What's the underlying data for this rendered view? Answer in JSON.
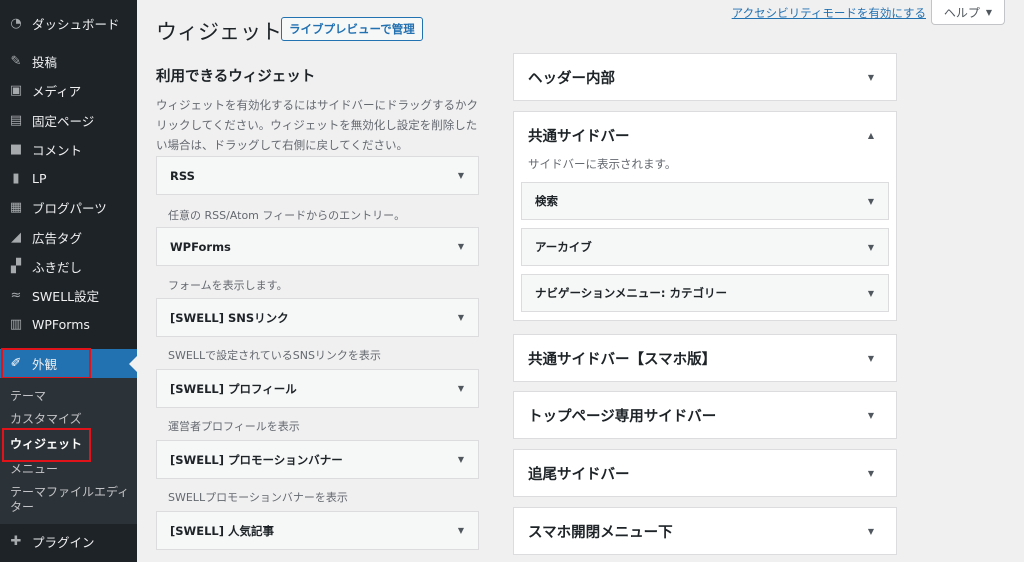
{
  "sidebar": {
    "items": [
      {
        "label": "ダッシュボード",
        "icon": "dashboard-icon",
        "glyph": "◔"
      },
      {
        "label": "投稿",
        "icon": "pin-icon",
        "glyph": "✎"
      },
      {
        "label": "メディア",
        "icon": "media-icon",
        "glyph": "▣"
      },
      {
        "label": "固定ページ",
        "icon": "page-icon",
        "glyph": "▤"
      },
      {
        "label": "コメント",
        "icon": "comment-icon",
        "glyph": "■"
      },
      {
        "label": "LP",
        "icon": "document-icon",
        "glyph": "▮"
      },
      {
        "label": "ブログパーツ",
        "icon": "grid-icon",
        "glyph": "▦"
      },
      {
        "label": "広告タグ",
        "icon": "megaphone-icon",
        "glyph": "◢"
      },
      {
        "label": "ふきだし",
        "icon": "speech-bubble-icon",
        "glyph": "▞"
      },
      {
        "label": "SWELL設定",
        "icon": "swell-logo-icon",
        "glyph": "≈"
      },
      {
        "label": "WPForms",
        "icon": "forms-icon",
        "glyph": "▥"
      },
      {
        "label": "外観",
        "icon": "paintbrush-icon",
        "glyph": "✐"
      },
      {
        "label": "プラグイン",
        "icon": "plugin-icon",
        "glyph": "✚"
      }
    ],
    "submenu": [
      "テーマ",
      "カスタマイズ",
      "ウィジェット",
      "メニュー",
      "テーマファイルエディター"
    ]
  },
  "header": {
    "title": "ウィジェット",
    "preview_button": "ライブプレビューで管理",
    "a11y_link": "アクセシビリティモードを有効にする",
    "help": "ヘルプ"
  },
  "available": {
    "title": "利用できるウィジェット",
    "description": "ウィジェットを有効化するにはサイドバーにドラッグするかクリックしてください。ウィジェットを無効化し設定を削除したい場合は、ドラッグして右側に戻してください。",
    "widgets": [
      {
        "title": "RSS",
        "desc": "任意の RSS/Atom フィードからのエントリー。"
      },
      {
        "title": "WPForms",
        "desc": "フォームを表示します。"
      },
      {
        "title": "[SWELL] SNSリンク",
        "desc": "SWELLで設定されているSNSリンクを表示"
      },
      {
        "title": "[SWELL] プロフィール",
        "desc": "運営者プロフィールを表示"
      },
      {
        "title": "[SWELL] プロモーションバナー",
        "desc": "SWELLプロモーションバナーを表示"
      },
      {
        "title": "[SWELL] 人気記事",
        "desc": ""
      }
    ]
  },
  "areas": {
    "header_inner": "ヘッダー内部",
    "common_sidebar": {
      "title": "共通サイドバー",
      "desc": "サイドバーに表示されます。",
      "widgets": [
        "検索",
        "アーカイブ",
        "ナビゲーションメニュー: カテゴリー"
      ]
    },
    "common_sidebar_sp": "共通サイドバー【スマホ版】",
    "top_sidebar": "トップページ専用サイドバー",
    "sticky_sidebar": "追尾サイドバー",
    "sp_menu_bottom": "スマホ開閉メニュー下"
  },
  "colors": {
    "accent": "#2271b1",
    "highlight_box": "#e0131b",
    "sidebar_bg": "#1d2327"
  }
}
